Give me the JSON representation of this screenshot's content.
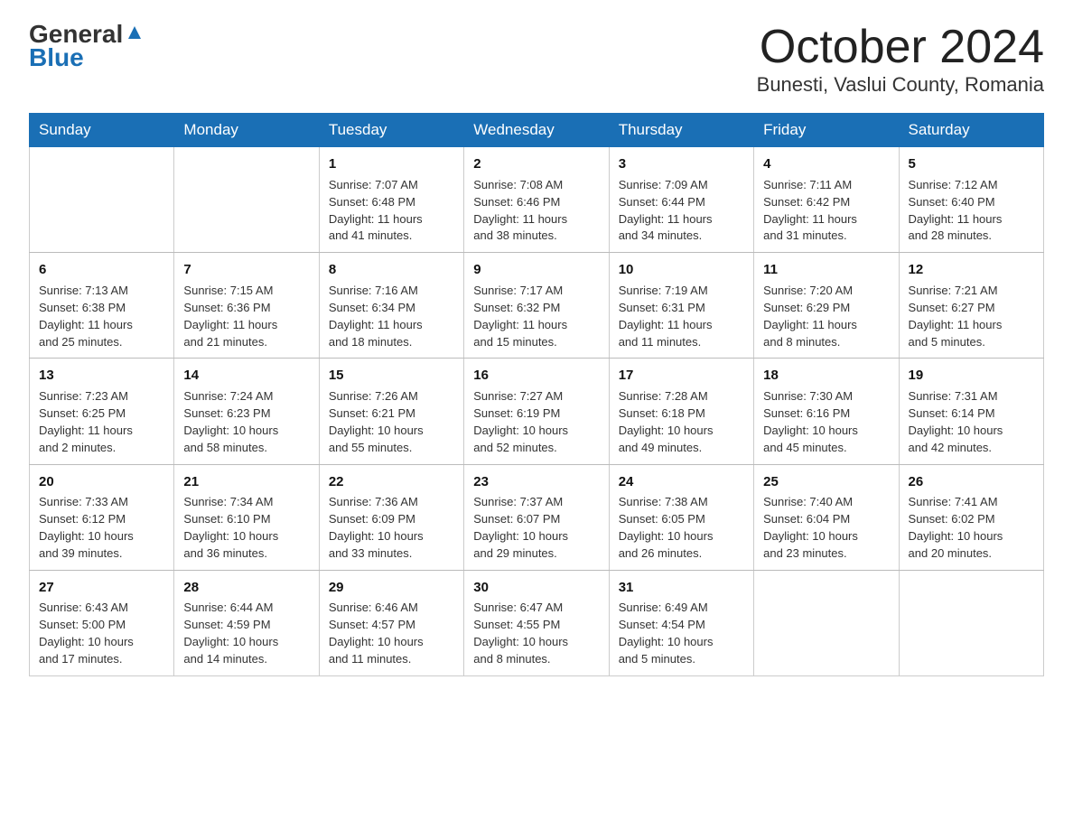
{
  "logo": {
    "line1": "General",
    "line2": "Blue"
  },
  "title": {
    "month": "October 2024",
    "location": "Bunesti, Vaslui County, Romania"
  },
  "weekdays": [
    "Sunday",
    "Monday",
    "Tuesday",
    "Wednesday",
    "Thursday",
    "Friday",
    "Saturday"
  ],
  "weeks": [
    [
      {
        "day": "",
        "info": ""
      },
      {
        "day": "",
        "info": ""
      },
      {
        "day": "1",
        "info": "Sunrise: 7:07 AM\nSunset: 6:48 PM\nDaylight: 11 hours\nand 41 minutes."
      },
      {
        "day": "2",
        "info": "Sunrise: 7:08 AM\nSunset: 6:46 PM\nDaylight: 11 hours\nand 38 minutes."
      },
      {
        "day": "3",
        "info": "Sunrise: 7:09 AM\nSunset: 6:44 PM\nDaylight: 11 hours\nand 34 minutes."
      },
      {
        "day": "4",
        "info": "Sunrise: 7:11 AM\nSunset: 6:42 PM\nDaylight: 11 hours\nand 31 minutes."
      },
      {
        "day": "5",
        "info": "Sunrise: 7:12 AM\nSunset: 6:40 PM\nDaylight: 11 hours\nand 28 minutes."
      }
    ],
    [
      {
        "day": "6",
        "info": "Sunrise: 7:13 AM\nSunset: 6:38 PM\nDaylight: 11 hours\nand 25 minutes."
      },
      {
        "day": "7",
        "info": "Sunrise: 7:15 AM\nSunset: 6:36 PM\nDaylight: 11 hours\nand 21 minutes."
      },
      {
        "day": "8",
        "info": "Sunrise: 7:16 AM\nSunset: 6:34 PM\nDaylight: 11 hours\nand 18 minutes."
      },
      {
        "day": "9",
        "info": "Sunrise: 7:17 AM\nSunset: 6:32 PM\nDaylight: 11 hours\nand 15 minutes."
      },
      {
        "day": "10",
        "info": "Sunrise: 7:19 AM\nSunset: 6:31 PM\nDaylight: 11 hours\nand 11 minutes."
      },
      {
        "day": "11",
        "info": "Sunrise: 7:20 AM\nSunset: 6:29 PM\nDaylight: 11 hours\nand 8 minutes."
      },
      {
        "day": "12",
        "info": "Sunrise: 7:21 AM\nSunset: 6:27 PM\nDaylight: 11 hours\nand 5 minutes."
      }
    ],
    [
      {
        "day": "13",
        "info": "Sunrise: 7:23 AM\nSunset: 6:25 PM\nDaylight: 11 hours\nand 2 minutes."
      },
      {
        "day": "14",
        "info": "Sunrise: 7:24 AM\nSunset: 6:23 PM\nDaylight: 10 hours\nand 58 minutes."
      },
      {
        "day": "15",
        "info": "Sunrise: 7:26 AM\nSunset: 6:21 PM\nDaylight: 10 hours\nand 55 minutes."
      },
      {
        "day": "16",
        "info": "Sunrise: 7:27 AM\nSunset: 6:19 PM\nDaylight: 10 hours\nand 52 minutes."
      },
      {
        "day": "17",
        "info": "Sunrise: 7:28 AM\nSunset: 6:18 PM\nDaylight: 10 hours\nand 49 minutes."
      },
      {
        "day": "18",
        "info": "Sunrise: 7:30 AM\nSunset: 6:16 PM\nDaylight: 10 hours\nand 45 minutes."
      },
      {
        "day": "19",
        "info": "Sunrise: 7:31 AM\nSunset: 6:14 PM\nDaylight: 10 hours\nand 42 minutes."
      }
    ],
    [
      {
        "day": "20",
        "info": "Sunrise: 7:33 AM\nSunset: 6:12 PM\nDaylight: 10 hours\nand 39 minutes."
      },
      {
        "day": "21",
        "info": "Sunrise: 7:34 AM\nSunset: 6:10 PM\nDaylight: 10 hours\nand 36 minutes."
      },
      {
        "day": "22",
        "info": "Sunrise: 7:36 AM\nSunset: 6:09 PM\nDaylight: 10 hours\nand 33 minutes."
      },
      {
        "day": "23",
        "info": "Sunrise: 7:37 AM\nSunset: 6:07 PM\nDaylight: 10 hours\nand 29 minutes."
      },
      {
        "day": "24",
        "info": "Sunrise: 7:38 AM\nSunset: 6:05 PM\nDaylight: 10 hours\nand 26 minutes."
      },
      {
        "day": "25",
        "info": "Sunrise: 7:40 AM\nSunset: 6:04 PM\nDaylight: 10 hours\nand 23 minutes."
      },
      {
        "day": "26",
        "info": "Sunrise: 7:41 AM\nSunset: 6:02 PM\nDaylight: 10 hours\nand 20 minutes."
      }
    ],
    [
      {
        "day": "27",
        "info": "Sunrise: 6:43 AM\nSunset: 5:00 PM\nDaylight: 10 hours\nand 17 minutes."
      },
      {
        "day": "28",
        "info": "Sunrise: 6:44 AM\nSunset: 4:59 PM\nDaylight: 10 hours\nand 14 minutes."
      },
      {
        "day": "29",
        "info": "Sunrise: 6:46 AM\nSunset: 4:57 PM\nDaylight: 10 hours\nand 11 minutes."
      },
      {
        "day": "30",
        "info": "Sunrise: 6:47 AM\nSunset: 4:55 PM\nDaylight: 10 hours\nand 8 minutes."
      },
      {
        "day": "31",
        "info": "Sunrise: 6:49 AM\nSunset: 4:54 PM\nDaylight: 10 hours\nand 5 minutes."
      },
      {
        "day": "",
        "info": ""
      },
      {
        "day": "",
        "info": ""
      }
    ]
  ]
}
